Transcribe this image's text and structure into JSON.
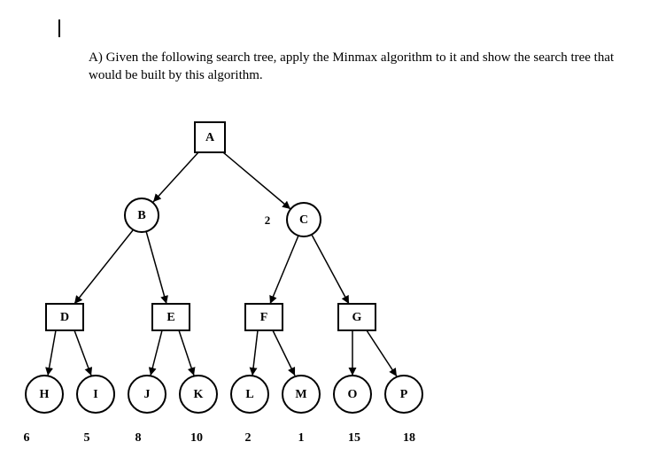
{
  "question": {
    "marker": "A)",
    "text": "Given the following search tree, apply the Minmax algorithm to it and show the search tree that would be built by this algorithm."
  },
  "tree": {
    "nodes": {
      "A": {
        "label": "A",
        "shape": "square"
      },
      "B": {
        "label": "B",
        "shape": "circle"
      },
      "C": {
        "label": "C",
        "shape": "circle"
      },
      "D": {
        "label": "D",
        "shape": "square"
      },
      "E": {
        "label": "E",
        "shape": "square"
      },
      "F": {
        "label": "F",
        "shape": "square"
      },
      "G": {
        "label": "G",
        "shape": "square"
      },
      "H": {
        "label": "H",
        "shape": "circle"
      },
      "I": {
        "label": "I",
        "shape": "circle"
      },
      "J": {
        "label": "J",
        "shape": "circle"
      },
      "K": {
        "label": "K",
        "shape": "circle"
      },
      "L": {
        "label": "L",
        "shape": "circle"
      },
      "M": {
        "label": "M",
        "shape": "circle"
      },
      "O": {
        "label": "O",
        "shape": "circle"
      },
      "P": {
        "label": "P",
        "shape": "circle"
      }
    },
    "edge_label_AC": "2",
    "leaf_values": {
      "H": "6",
      "I": "5",
      "J": "8",
      "K": "10",
      "L": "2",
      "M": "1",
      "O": "15",
      "P": "18"
    }
  },
  "chart_data": {
    "type": "tree",
    "title": "Minmax search tree",
    "root": "A",
    "node_shapes": {
      "square": "max-node",
      "circle": "min-node-or-terminal"
    },
    "edges": [
      [
        "A",
        "B"
      ],
      [
        "A",
        "C"
      ],
      [
        "B",
        "D"
      ],
      [
        "B",
        "E"
      ],
      [
        "C",
        "F"
      ],
      [
        "C",
        "G"
      ],
      [
        "D",
        "H"
      ],
      [
        "D",
        "I"
      ],
      [
        "E",
        "J"
      ],
      [
        "E",
        "K"
      ],
      [
        "F",
        "L"
      ],
      [
        "F",
        "M"
      ],
      [
        "G",
        "O"
      ],
      [
        "G",
        "P"
      ]
    ],
    "edge_labels": {
      "A-C": 2
    },
    "terminal_values": {
      "H": 6,
      "I": 5,
      "J": 8,
      "K": 10,
      "L": 2,
      "M": 1,
      "O": 15,
      "P": 18
    }
  }
}
